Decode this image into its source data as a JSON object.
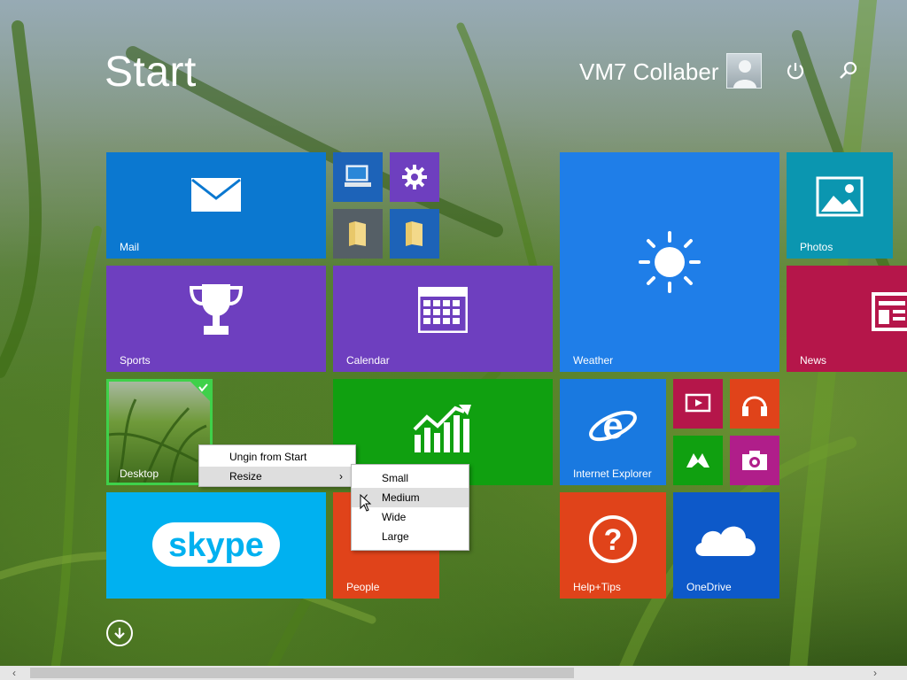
{
  "header": {
    "title": "Start",
    "user_name": "VM7 Collaber"
  },
  "tiles": {
    "mail": "Mail",
    "sports": "Sports",
    "calendar": "Calendar",
    "weather": "Weather",
    "photos": "Photos",
    "news": "News",
    "desktop": "Desktop",
    "internet_explorer": "Internet Explorer",
    "people": "People",
    "help_tips": "Help+Tips",
    "onedrive": "OneDrive",
    "skype": "skype"
  },
  "context_menu": {
    "unpin": "Ungin from Start",
    "resize": "Resize",
    "arrow": "›"
  },
  "resize_menu": {
    "small": "Small",
    "medium": "Medium",
    "wide": "Wide",
    "large": "Large",
    "selected": "Medium",
    "check": "✓"
  },
  "colors": {
    "mail": "#0b78d0",
    "sports": "#6e3fbf",
    "calendar": "#6e3fbf",
    "weather": "#1f7ee8",
    "photos": "#0b96b0",
    "news": "#b5164a",
    "finance": "#10a010",
    "ie": "#1979e0",
    "skype": "#00b1f0",
    "people": "#e0431a",
    "help": "#e0431a",
    "onedrive": "#0d59c9",
    "video": "#b5164a",
    "music": "#e0431a",
    "games": "#10a010",
    "camera": "#b01e8a",
    "pc": "#1d63b8",
    "settings": "#6e3fbf",
    "folder1": "#555f66",
    "folder2": "#1d63b8"
  }
}
